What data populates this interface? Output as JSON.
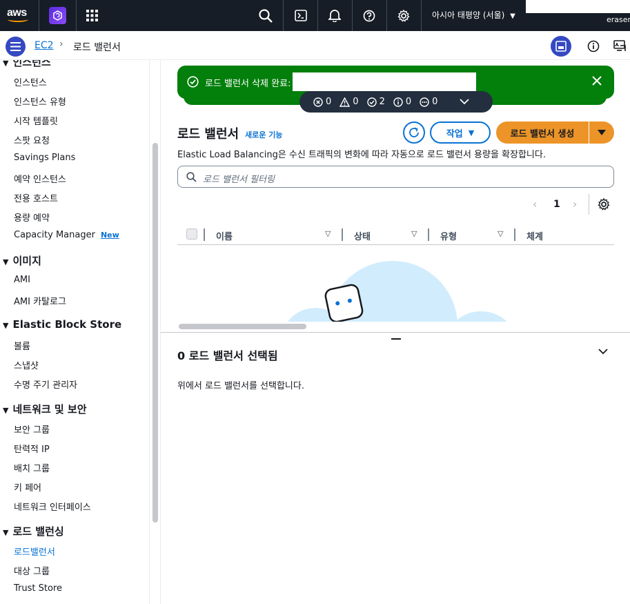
{
  "topbar": {
    "logo_text": "aws",
    "region": "아시아 태평양 (서울)",
    "eraser_label": "eraser",
    "icons": [
      "search-icon",
      "cloudshell-icon",
      "bell-icon",
      "help-icon",
      "gear-icon"
    ]
  },
  "breadcrumb": {
    "root": "EC2",
    "separator": "›",
    "current": "로드 밸런서"
  },
  "sidebar": {
    "partial_section": "인스턴스",
    "sections": [
      {
        "title": "",
        "items": [
          "인스턴스",
          "인스턴스 유형",
          "시작 템플릿",
          "스팟 요청",
          "Savings Plans",
          "예약 인스턴스",
          "전용 호스트",
          "용량 예약",
          "Capacity Manager"
        ]
      },
      {
        "title": "이미지",
        "items": [
          "AMI",
          "AMI 카탈로그"
        ]
      },
      {
        "title": "Elastic Block Store",
        "items": [
          "볼륨",
          "스냅샷",
          "수명 주기 관리자"
        ]
      },
      {
        "title": "네트워크 및 보안",
        "items": [
          "보안 그룹",
          "탄력적 IP",
          "배치 그룹",
          "키 페어",
          "네트워크 인터페이스"
        ]
      },
      {
        "title": "로드 밸런싱",
        "items": [
          "로드밸런서",
          "대상 그룹",
          "Trust Store"
        ]
      }
    ],
    "new_badge": "New",
    "active_item": "로드밸런서"
  },
  "flash": {
    "message": "로드 밸런서 삭제 완료:",
    "counters": {
      "error": "0",
      "warning": "0",
      "success": "2",
      "info": "0",
      "in_progress": "0"
    }
  },
  "main": {
    "title": "로드 밸런서",
    "new_feature": "새로운 기능",
    "action_label": "작업",
    "create_label": "로드 밸런서 생성",
    "description": "Elastic Load Balancing은 수신 트래픽의 변화에 따라 자동으로 로드 밸런서 용량을 확장합니다.",
    "filter_placeholder": "로드 밸런서 필터링",
    "page": "1",
    "columns": [
      "이름",
      "상태",
      "유형",
      "체계"
    ]
  },
  "selection": {
    "title": "0 로드 밸런서 선택됨",
    "description": "위에서 로드 밸런서를 선택합니다."
  },
  "colors": {
    "topbar": "#161d26",
    "accent": "#0972d3",
    "primary_button": "#ec9428",
    "success": "#037f0c"
  }
}
